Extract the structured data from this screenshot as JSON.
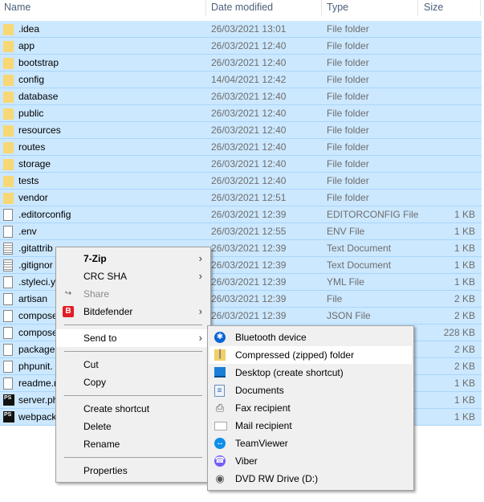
{
  "columns": {
    "name": "Name",
    "date": "Date modified",
    "type": "Type",
    "size": "Size"
  },
  "files": [
    {
      "name": ".idea",
      "date": "26/03/2021 13:01",
      "type": "File folder",
      "size": "",
      "icon": "folder"
    },
    {
      "name": "app",
      "date": "26/03/2021 12:40",
      "type": "File folder",
      "size": "",
      "icon": "folder"
    },
    {
      "name": "bootstrap",
      "date": "26/03/2021 12:40",
      "type": "File folder",
      "size": "",
      "icon": "folder"
    },
    {
      "name": "config",
      "date": "14/04/2021 12:42",
      "type": "File folder",
      "size": "",
      "icon": "folder"
    },
    {
      "name": "database",
      "date": "26/03/2021 12:40",
      "type": "File folder",
      "size": "",
      "icon": "folder"
    },
    {
      "name": "public",
      "date": "26/03/2021 12:40",
      "type": "File folder",
      "size": "",
      "icon": "folder"
    },
    {
      "name": "resources",
      "date": "26/03/2021 12:40",
      "type": "File folder",
      "size": "",
      "icon": "folder"
    },
    {
      "name": "routes",
      "date": "26/03/2021 12:40",
      "type": "File folder",
      "size": "",
      "icon": "folder"
    },
    {
      "name": "storage",
      "date": "26/03/2021 12:40",
      "type": "File folder",
      "size": "",
      "icon": "folder"
    },
    {
      "name": "tests",
      "date": "26/03/2021 12:40",
      "type": "File folder",
      "size": "",
      "icon": "folder"
    },
    {
      "name": "vendor",
      "date": "26/03/2021 12:51",
      "type": "File folder",
      "size": "",
      "icon": "folder"
    },
    {
      "name": ".editorconfig",
      "date": "26/03/2021 12:39",
      "type": "EDITORCONFIG File",
      "size": "1 KB",
      "icon": "file"
    },
    {
      "name": ".env",
      "date": "26/03/2021 12:55",
      "type": "ENV File",
      "size": "1 KB",
      "icon": "file"
    },
    {
      "name": ".gitattrib",
      "date": "26/03/2021 12:39",
      "type": "Text Document",
      "size": "1 KB",
      "icon": "text"
    },
    {
      "name": ".gitignor",
      "date": "26/03/2021 12:39",
      "type": "Text Document",
      "size": "1 KB",
      "icon": "text"
    },
    {
      "name": ".styleci.y",
      "date": "26/03/2021 12:39",
      "type": "YML File",
      "size": "1 KB",
      "icon": "file"
    },
    {
      "name": "artisan",
      "date": "26/03/2021 12:39",
      "type": "File",
      "size": "2 KB",
      "icon": "file"
    },
    {
      "name": "compose",
      "date": "26/03/2021 12:39",
      "type": "JSON File",
      "size": "2 KB",
      "icon": "file"
    },
    {
      "name": "compose",
      "date": "",
      "type": "",
      "size": "228 KB",
      "icon": "file"
    },
    {
      "name": "package.",
      "date": "",
      "type": "",
      "size": "2 KB",
      "icon": "file"
    },
    {
      "name": "phpunit.",
      "date": "",
      "type": "",
      "size": "2 KB",
      "icon": "xml"
    },
    {
      "name": "readme.r",
      "date": "",
      "type": "",
      "size": "1 KB",
      "icon": "file"
    },
    {
      "name": "server.ph",
      "date": "",
      "type": "",
      "size": "1 KB",
      "icon": "ps"
    },
    {
      "name": "webpack",
      "date": "",
      "type": "",
      "size": "1 KB",
      "icon": "ps"
    }
  ],
  "context_menu": {
    "seven_zip": "7-Zip",
    "crc_sha": "CRC SHA",
    "share": "Share",
    "bitdefender": "Bitdefender",
    "send_to": "Send to",
    "cut": "Cut",
    "copy": "Copy",
    "create_shortcut": "Create shortcut",
    "delete": "Delete",
    "rename": "Rename",
    "properties": "Properties"
  },
  "send_to_menu": [
    {
      "label": "Bluetooth device",
      "icon": "bluetooth-icon"
    },
    {
      "label": "Compressed (zipped) folder",
      "icon": "zip-folder-icon"
    },
    {
      "label": "Desktop (create shortcut)",
      "icon": "desktop-icon"
    },
    {
      "label": "Documents",
      "icon": "documents-icon"
    },
    {
      "label": "Fax recipient",
      "icon": "fax-icon"
    },
    {
      "label": "Mail recipient",
      "icon": "mail-icon"
    },
    {
      "label": "TeamViewer",
      "icon": "teamviewer-icon"
    },
    {
      "label": "Viber",
      "icon": "viber-icon"
    },
    {
      "label": "DVD RW Drive (D:)",
      "icon": "dvd-drive-icon"
    }
  ],
  "colors": {
    "selection": "#cce8ff",
    "hover": "#ffffff",
    "menu_bg": "#f0f0f0",
    "bitdefender": "#e21e26"
  }
}
